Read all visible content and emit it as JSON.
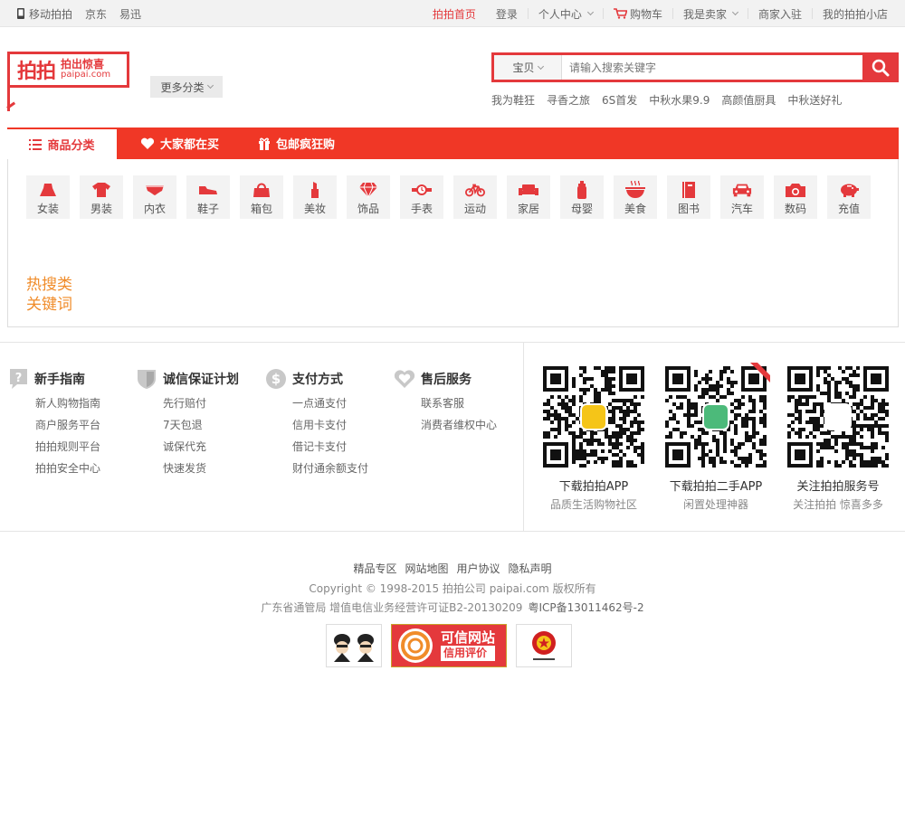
{
  "topbar": {
    "mobile": "移动拍拍",
    "jd": "京东",
    "yixun": "易迅",
    "home": "拍拍首页",
    "login": "登录",
    "personal": "个人中心",
    "cart": "购物车",
    "seller": "我是卖家",
    "merchant": "商家入驻",
    "myshop": "我的拍拍小店"
  },
  "logo": {
    "main": "拍拍",
    "sub_cn": "拍出惊喜",
    "sub_en": "paipai.com"
  },
  "more_category": "更多分类",
  "search": {
    "type": "宝贝",
    "placeholder": "请输入搜索关键字"
  },
  "hotwords": [
    "我为鞋狂",
    "寻香之旅",
    "6S首发",
    "中秋水果9.9",
    "高颜值厨具",
    "中秋送好礼"
  ],
  "nav": {
    "tabs": [
      "商品分类",
      "大家都在买",
      "包邮疯狂购"
    ]
  },
  "categories": [
    "女装",
    "男装",
    "内衣",
    "鞋子",
    "箱包",
    "美妆",
    "饰品",
    "手表",
    "运动",
    "家居",
    "母婴",
    "美食",
    "图书",
    "汽车",
    "数码",
    "充值"
  ],
  "hotsearch": [
    "热搜类",
    "关键词"
  ],
  "guides": [
    {
      "title": "新手指南",
      "links": [
        "新人购物指南",
        "商户服务平台",
        "拍拍规则平台",
        "拍拍安全中心"
      ]
    },
    {
      "title": "诚信保证计划",
      "links": [
        "先行赔付",
        "7天包退",
        "诚保代充",
        "快速发货"
      ]
    },
    {
      "title": "支付方式",
      "links": [
        "一点通支付",
        "信用卡支付",
        "借记卡支付",
        "财付通余额支付"
      ]
    },
    {
      "title": "售后服务",
      "links": [
        "联系客服",
        "消费者维权中心"
      ]
    }
  ],
  "qrcodes": [
    {
      "title": "下载拍拍APP",
      "sub": "品质生活购物社区"
    },
    {
      "title": "下载拍拍二手APP",
      "sub": "闲置处理神器"
    },
    {
      "title": "关注拍拍服务号",
      "sub": "关注拍拍 惊喜多多"
    }
  ],
  "footer": {
    "links": [
      "精品专区",
      "网站地图",
      "用户协议",
      "隐私声明"
    ],
    "copyright": "Copyright © 1998-2015 拍拍公司 paipai.com 版权所有",
    "license": "广东省通管局 增值电信业务经营许可证B2-20130209",
    "icp": "粤ICP备13011462号-2",
    "trust_badge": [
      "可信网站",
      "信用评价"
    ]
  },
  "colors": {
    "brand": "#e4393c",
    "nav_bg": "#f03726",
    "hot": "#f08c2a"
  }
}
